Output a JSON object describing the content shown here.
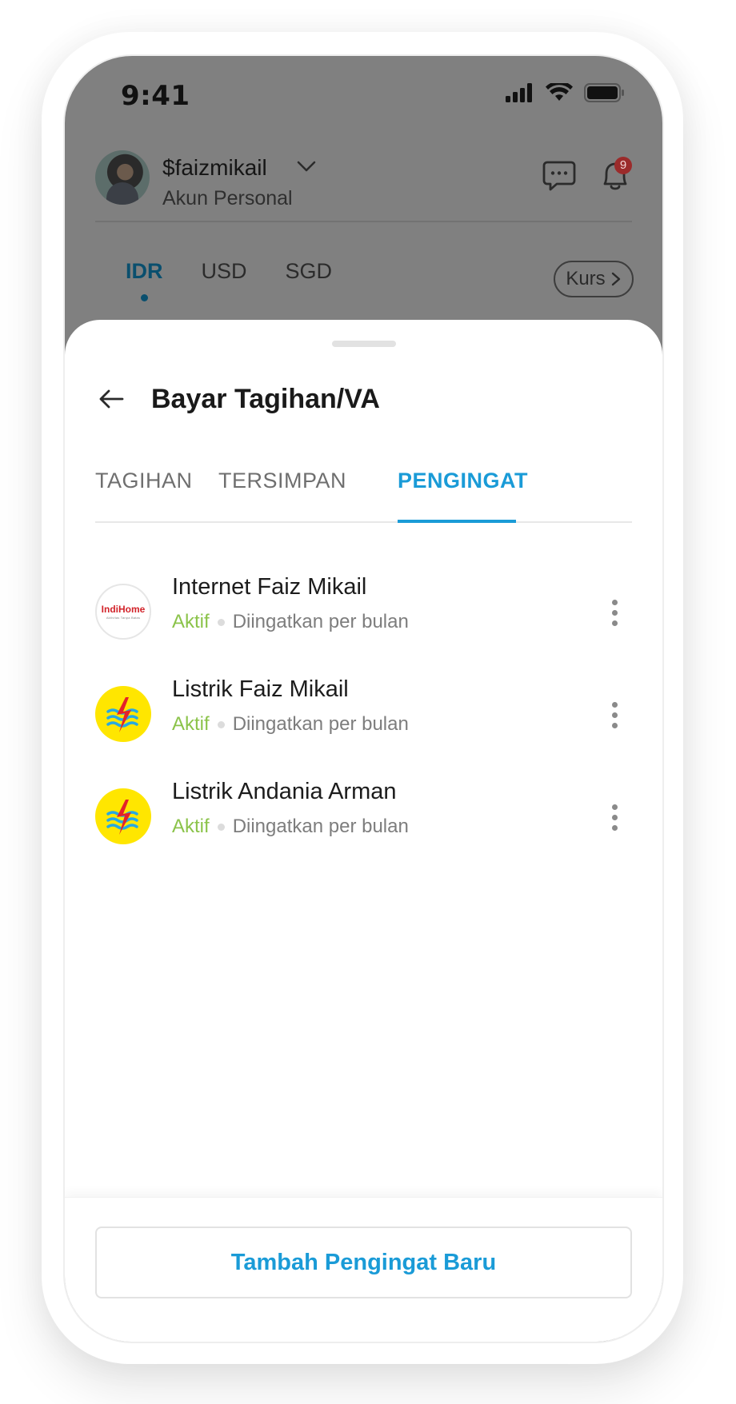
{
  "status_bar": {
    "time": "9:41"
  },
  "account": {
    "username": "$faizmikail",
    "type": "Akun Personal",
    "notification_count": "9"
  },
  "currency": {
    "tabs": [
      "IDR",
      "USD",
      "SGD"
    ],
    "active": "IDR",
    "kurs_label": "Kurs"
  },
  "sheet": {
    "title": "Bayar Tagihan/VA",
    "tabs": [
      {
        "label": "TAGIHAN",
        "active": false
      },
      {
        "label": "TERSIMPAN",
        "active": false
      },
      {
        "label": "PENGINGAT",
        "active": true
      }
    ],
    "reminders": [
      {
        "name": "Internet Faiz Mikail",
        "status": "Aktif",
        "frequency": "Diingatkan per bulan",
        "logo": "indihome-logo",
        "logo_text": "IndiHome",
        "logo_subtext": "Aktivitas Tanpa Batas"
      },
      {
        "name": "Listrik Faiz Mikail",
        "status": "Aktif",
        "frequency": "Diingatkan per bulan",
        "logo": "pln-logo"
      },
      {
        "name": "Listrik Andania Arman",
        "status": "Aktif",
        "frequency": "Diingatkan per bulan",
        "logo": "pln-logo"
      }
    ],
    "add_button_label": "Tambah Pengingat Baru"
  },
  "colors": {
    "accent": "#1a9bd7",
    "active_status": "#8bc34a",
    "overlay": "#808080",
    "pln_yellow": "#ffe600",
    "indihome_red": "#d2232a"
  }
}
